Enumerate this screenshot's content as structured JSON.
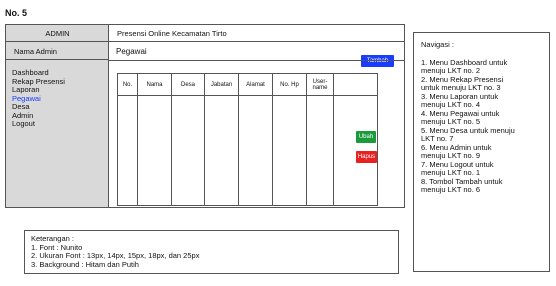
{
  "page_label": "No. 5",
  "sidebar": {
    "header": "ADMIN",
    "user": "Nama Admin",
    "items": [
      {
        "label": "Dashboard",
        "active": false
      },
      {
        "label": "Rekap Presensi",
        "active": false
      },
      {
        "label": "Laporan",
        "active": false
      },
      {
        "label": "Pegawai",
        "active": true
      },
      {
        "label": "Desa",
        "active": false
      },
      {
        "label": "Admin",
        "active": false
      },
      {
        "label": "Logout",
        "active": false
      }
    ]
  },
  "topbar": {
    "title": "Presensi Online Kecamatan Tirto"
  },
  "content": {
    "title": "Pegawai",
    "add_button": "Tambah",
    "table_headers": [
      "No.",
      "Nama",
      "Desa",
      "Jabatan",
      "Alamat",
      "No. Hp",
      "User-name"
    ],
    "edit_button": "Ubah",
    "delete_button": "Hapus"
  },
  "notes": {
    "title": "Keterangan :",
    "lines": [
      "1. Font : Nunito",
      "2. Ukuran Font : 13px, 14px, 15px, 18px, dan 25px",
      "3. Background : Hitam dan Putih"
    ]
  },
  "navigation": {
    "title": "Navigasi :",
    "lines": [
      "1. Menu Dashboard untuk",
      "menuju LKT no. 2",
      "2. Menu Rekap Presensi",
      "untuk menuju LKT no. 3",
      "3. Menu Laporan untuk",
      "menuju LKT no. 4",
      "4. Menu Pegawai untuk",
      "menuju LKT no. 5",
      "5. Menu Desa untuk menuju",
      "LKT no. 7",
      "6. Menu Admin untuk",
      "menuju LKT no. 9",
      "7. Menu Logout untuk",
      "menuju LKT no. 1",
      "8. Tombol Tambah untuk",
      "menuju LKT no. 6"
    ]
  },
  "colors": {
    "sidebar_bg": "#d9d9d9",
    "active_link": "#1a3cff",
    "add": "#1a3cff",
    "edit": "#1a9a3a",
    "delete": "#e82020"
  }
}
